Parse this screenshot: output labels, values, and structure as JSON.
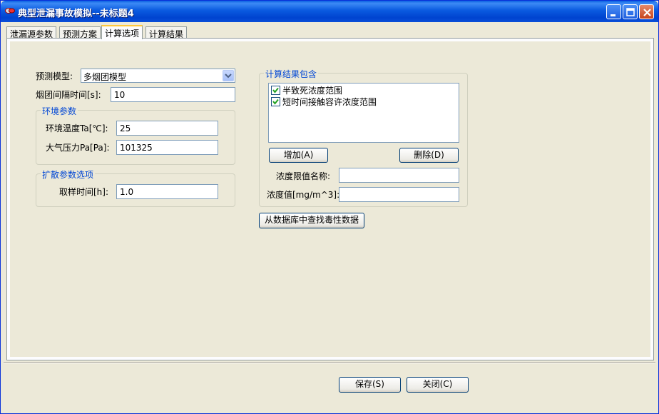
{
  "window": {
    "title": "典型泄漏事故模拟--未标题4"
  },
  "tabs": [
    {
      "label": "泄漏源参数"
    },
    {
      "label": "预测方案"
    },
    {
      "label": "计算选项"
    },
    {
      "label": "计算结果"
    }
  ],
  "active_tab": "计算选项",
  "left": {
    "model_label": "预测模型:",
    "model_value": "多烟团模型",
    "interval_label": "烟团间隔时间[s]:",
    "interval_value": "10",
    "env_group": {
      "title": "环境参数",
      "temp_label": "环境温度Ta[℃]:",
      "temp_value": "25",
      "pressure_label": "大气压力Pa[Pa]:",
      "pressure_value": "101325"
    },
    "diffusion_group": {
      "title": "扩散参数选项",
      "sample_label": "取样时间[h]:",
      "sample_value": "1.0"
    }
  },
  "right": {
    "results_group": {
      "title": "计算结果包含",
      "items": [
        {
          "label": "半致死浓度范围",
          "checked": true
        },
        {
          "label": "短时间接触容许浓度范围",
          "checked": true
        }
      ],
      "add_label": "增加(A)",
      "delete_label": "删除(D)",
      "limit_name_label": "浓度限值名称:",
      "limit_name_value": "",
      "conc_label": "浓度值[mg/m^3]:",
      "conc_value": ""
    },
    "db_button_label": "从数据库中查找毒性数据"
  },
  "footer": {
    "save_label": "保存(S)",
    "close_label": "关闭(C)"
  },
  "colors": {
    "titlebar": "#0a5ae0",
    "group_title": "#0046d5",
    "face": "#ece9d8"
  }
}
